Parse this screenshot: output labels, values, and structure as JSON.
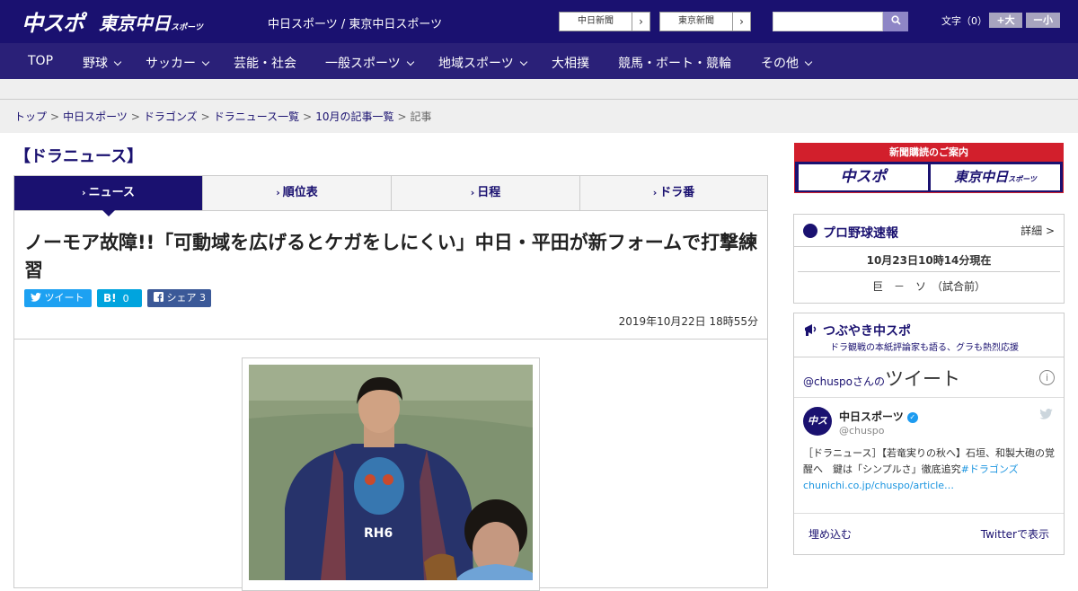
{
  "header": {
    "logo_main": "中スポ",
    "logo_tokyo": "東京中日",
    "logo_tokyo_suffix": "スポーツ",
    "site_name": "中日スポーツ / 東京中日スポーツ",
    "ext_links": [
      {
        "label": "中日新聞"
      },
      {
        "label": "東京新聞"
      }
    ],
    "search": {
      "placeholder": ""
    },
    "font_size_label": "文字（0）",
    "font_plus": "+大",
    "font_minus": "ー小"
  },
  "nav": {
    "items": [
      {
        "label": "TOP",
        "has_menu": false
      },
      {
        "label": "野球",
        "has_menu": true
      },
      {
        "label": "サッカー",
        "has_menu": true
      },
      {
        "label": "芸能・社会",
        "has_menu": false
      },
      {
        "label": "一般スポーツ",
        "has_menu": true
      },
      {
        "label": "地域スポーツ",
        "has_menu": true
      },
      {
        "label": "大相撲",
        "has_menu": false
      },
      {
        "label": "競馬・ボート・競輪",
        "has_menu": false
      },
      {
        "label": "その他",
        "has_menu": true
      }
    ]
  },
  "breadcrumb": {
    "items": [
      "トップ",
      "中日スポーツ",
      "ドラゴンズ",
      "ドラニュース一覧",
      "10月の記事一覧"
    ],
    "current": "記事",
    "separator": ">"
  },
  "section_title": "【ドラニュース】",
  "tabs": [
    {
      "label": "ニュース",
      "active": true
    },
    {
      "label": "順位表",
      "active": false
    },
    {
      "label": "日程",
      "active": false
    },
    {
      "label": "ドラ番",
      "active": false
    }
  ],
  "article": {
    "headline": "ノーモア故障!!「可動域を広げるとケガをしにくい」中日・平田が新フォームで打撃練習",
    "share": {
      "tweet_label": "ツイート",
      "hatena_label": "B!",
      "hatena_count": "0",
      "facebook_label": "シェア",
      "facebook_count": "3"
    },
    "date": "2019年10月22日 18時55分",
    "photo_jersey_text": "RH6"
  },
  "sidebar": {
    "subscribe": {
      "title": "新聞購読のご案内",
      "btn1": "中スポ",
      "btn2": "東京中日",
      "btn2_suffix": "スポーツ"
    },
    "scores": {
      "title": "プロ野球速報",
      "more_label": "詳細 >",
      "as_of": "10月23日10時14分現在",
      "game": "巨　－　ソ　（試合前）"
    },
    "tweets": {
      "title": "つぶやき中スポ",
      "subtitle": "ドラ観戦の本紙評論家も語る、グラも熱烈応援",
      "timeline_handle": "@chuspo",
      "timeline_suffix": "さんの",
      "timeline_label": "ツイート",
      "avatar_text": "中スポ",
      "user_name": "中日スポーツ",
      "user_handle": "@chuspo",
      "body_text": "［ドラニュース］【若竜実りの秋へ】石垣、和製大砲の覚醒へ　鍵は「シンプルさ」徹底追究",
      "body_link": "#ドラゴンズchunichi.co.jp/chuspo/article…",
      "embed_label": "埋め込む",
      "view_label": "Twitterで表示"
    }
  },
  "colors": {
    "brand_navy": "#1a1170",
    "nav_bg": "#2a2078",
    "accent_red": "#d21f2c",
    "twitter": "#1d9bf0"
  },
  "icons": [
    "search-icon",
    "chevron-right-icon",
    "chevron-down-icon",
    "twitter-bird-icon",
    "facebook-icon",
    "baseball-icon",
    "megaphone-icon",
    "info-icon",
    "verified-badge-icon"
  ]
}
